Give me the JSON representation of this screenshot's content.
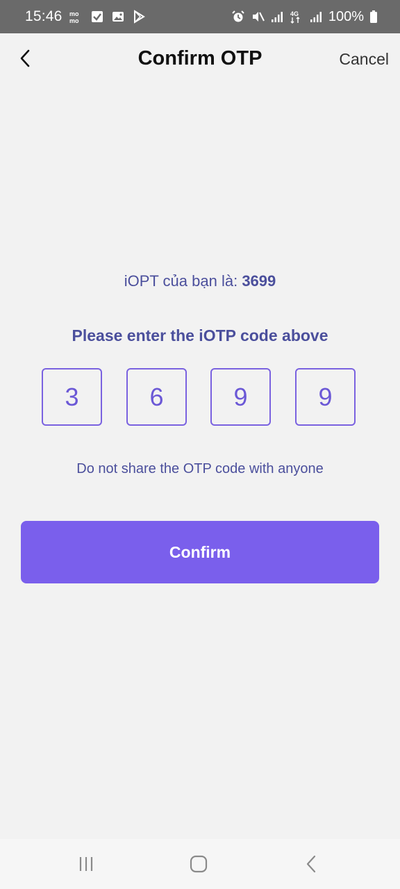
{
  "status_bar": {
    "time": "15:46",
    "battery": "100%",
    "left_icons": [
      "momo-icon",
      "check-box-icon",
      "image-icon",
      "play-store-icon"
    ],
    "right_icons": [
      "alarm-icon",
      "mute-icon",
      "signal-icon",
      "4g-icon",
      "signal-icon",
      "battery-icon"
    ]
  },
  "header": {
    "title": "Confirm OTP",
    "cancel_label": "Cancel"
  },
  "otp": {
    "info_prefix": "iOPT của bạn là: ",
    "code": "3699",
    "instruction": "Please enter the iOTP code above",
    "digits": [
      "3",
      "6",
      "9",
      "9"
    ],
    "warning": "Do not share the OTP code with anyone"
  },
  "actions": {
    "confirm_label": "Confirm"
  },
  "colors": {
    "accent": "#7a5fec",
    "text_primary": "#4b4f9c",
    "status_bar": "#6a6a6a",
    "background": "#f2f2f2"
  }
}
